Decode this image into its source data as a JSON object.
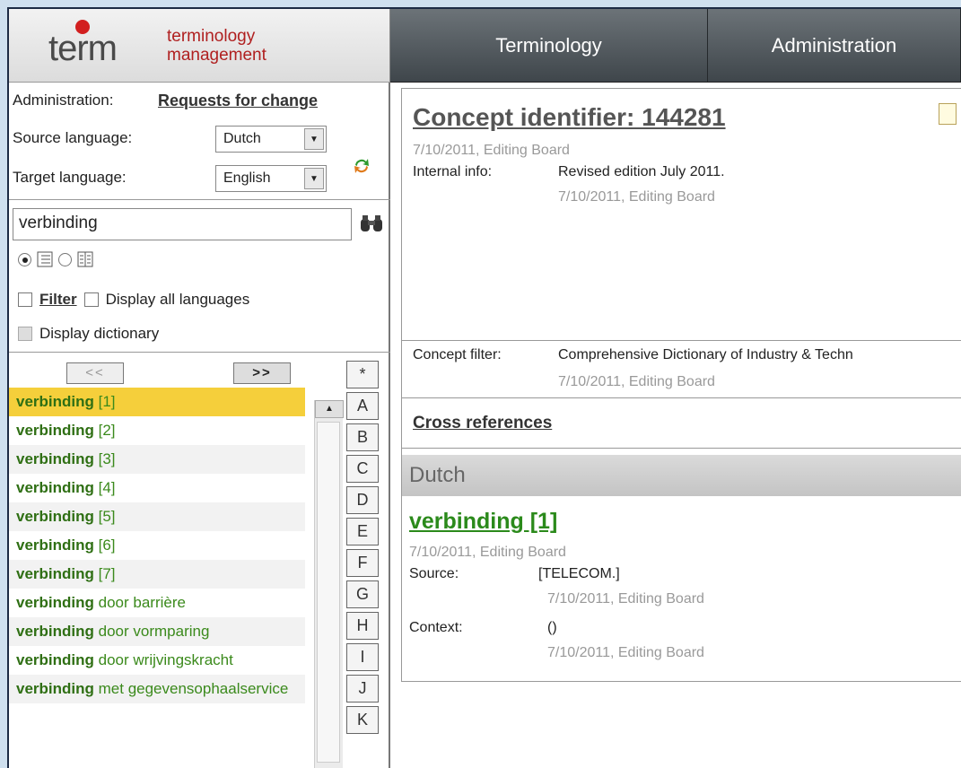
{
  "brand": {
    "logo_word": "term",
    "tagline_1": "terminology",
    "tagline_2": "management"
  },
  "nav": {
    "items": [
      "Terminology",
      "Administration"
    ]
  },
  "left": {
    "admin_label": "Administration:",
    "admin_link": "Requests for change",
    "source_label": "Source language:",
    "source_value": "Dutch",
    "target_label": "Target language:",
    "target_value": "English",
    "search_value": "verbinding",
    "filter_label": "Filter",
    "display_all_label": "Display all languages",
    "display_dict_label": "Display dictionary",
    "prev_label": "<<",
    "next_label": ">>",
    "results": [
      {
        "term": "verbinding",
        "rest": " [1]",
        "selected": true
      },
      {
        "term": "verbinding",
        "rest": " [2]"
      },
      {
        "term": "verbinding",
        "rest": " [3]"
      },
      {
        "term": "verbinding",
        "rest": " [4]"
      },
      {
        "term": "verbinding",
        "rest": " [5]"
      },
      {
        "term": "verbinding",
        "rest": " [6]"
      },
      {
        "term": "verbinding",
        "rest": " [7]"
      },
      {
        "term": "verbinding",
        "rest": " door barrière"
      },
      {
        "term": "verbinding",
        "rest": " door vormparing"
      },
      {
        "term": "verbinding",
        "rest": " door wrijvingskracht"
      },
      {
        "term": "verbinding",
        "rest": " met gegevensophaalservice"
      }
    ],
    "alphabet": [
      "*",
      "A",
      "B",
      "C",
      "D",
      "E",
      "F",
      "G",
      "H",
      "I",
      "J",
      "K"
    ]
  },
  "concept": {
    "title": "Concept identifier: 144281",
    "meta": "7/10/2011, Editing Board",
    "internal_label": "Internal info:",
    "internal_value": "Revised edition July 2011.",
    "internal_meta": "7/10/2011, Editing Board",
    "filter_label": "Concept filter:",
    "filter_value": "Comprehensive Dictionary of Industry & Techn",
    "filter_meta": "7/10/2011, Editing Board",
    "cross_refs": "Cross references"
  },
  "term_section": {
    "language": "Dutch",
    "term": "verbinding [1]",
    "meta": "7/10/2011, Editing Board",
    "source_label": "Source:",
    "source_value": "[TELECOM.]",
    "source_meta": "7/10/2011, Editing Board",
    "context_label": "Context:",
    "context_value": "()",
    "context_meta": "7/10/2011, Editing Board"
  },
  "colors": {
    "accent_green": "#2b8a1b",
    "selection": "#f5cf3b",
    "brand_red": "#b02020"
  }
}
